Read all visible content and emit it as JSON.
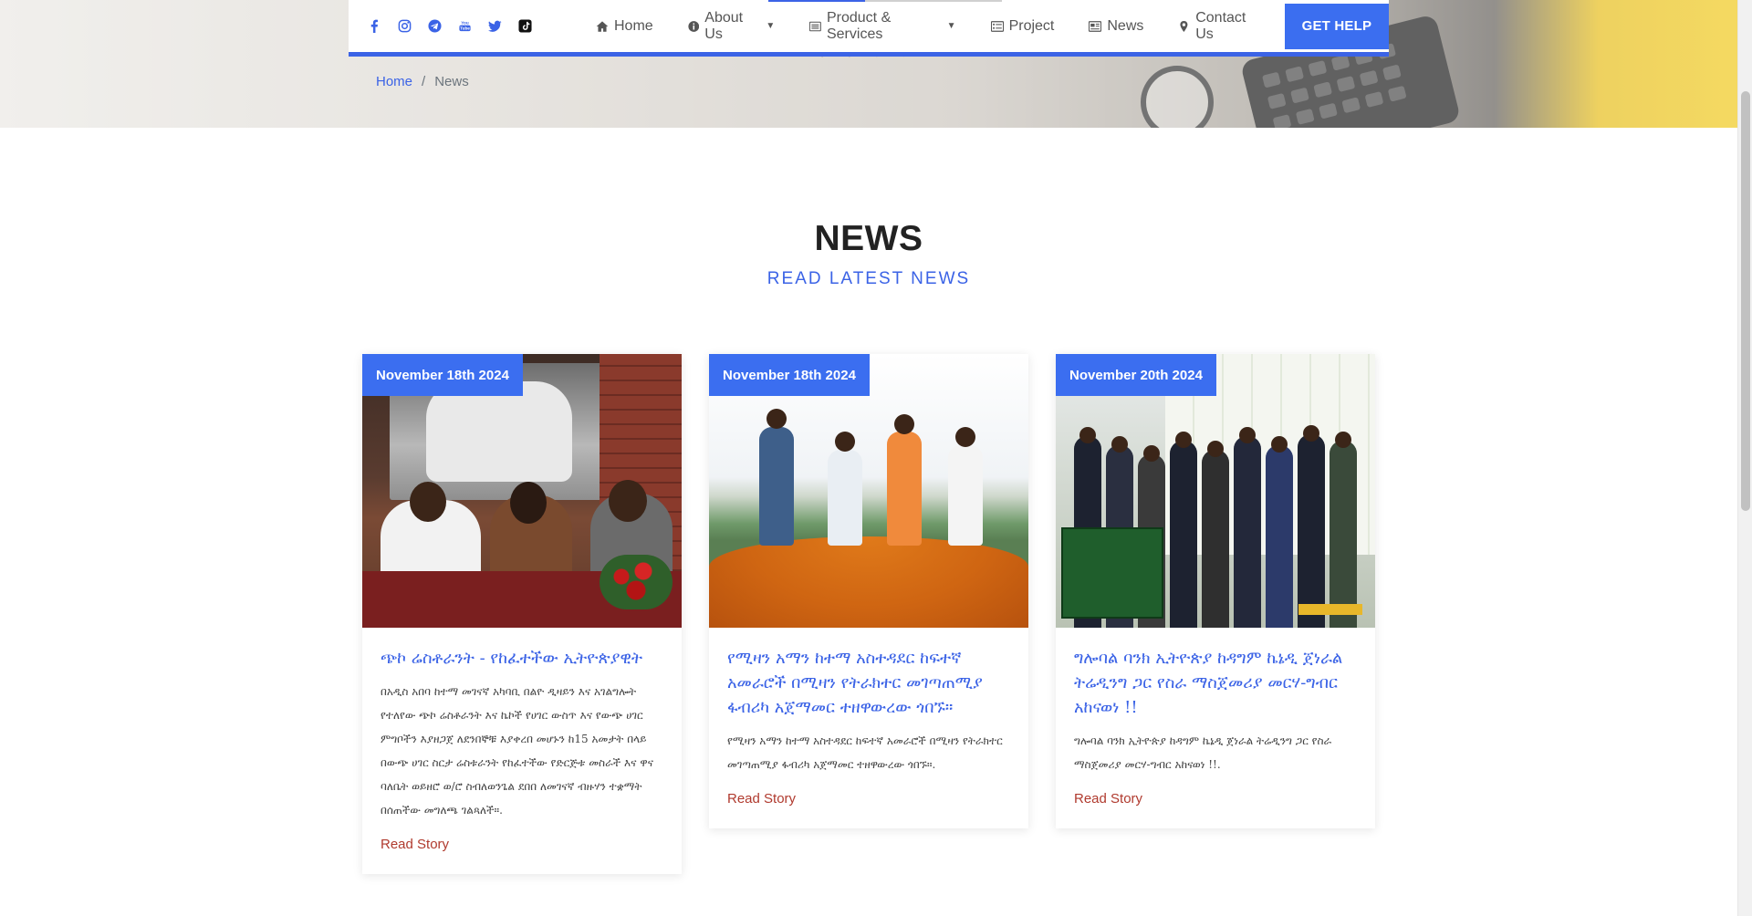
{
  "colors": {
    "accent": "#3b6ef0",
    "link": "#3b63e6",
    "read_more": "#b03a2e"
  },
  "social_icons": [
    "facebook-icon",
    "instagram-icon",
    "telegram-icon",
    "youtube-icon",
    "twitter-icon",
    "tiktok-icon"
  ],
  "nav": {
    "items": [
      {
        "label": "Home",
        "icon": "home-icon"
      },
      {
        "label": "About Us",
        "icon": "info-icon",
        "dropdown": true
      },
      {
        "label": "Product & Services",
        "icon": "list-icon",
        "dropdown": true
      },
      {
        "label": "Project",
        "icon": "tasks-icon"
      },
      {
        "label": "News",
        "icon": "newspaper-icon"
      },
      {
        "label": "Contact Us",
        "icon": "map-marker-icon"
      }
    ],
    "cta": "GET HELP"
  },
  "breadcrumb": {
    "home": "Home",
    "separator": "/",
    "current": "News"
  },
  "section": {
    "title": "NEWS",
    "subtitle": "READ LATEST NEWS"
  },
  "cards": [
    {
      "date": "November 18th 2024",
      "title": "ጭኮ ሬስቶራንት - የከፈተችው ኢትዮጵያዊት",
      "excerpt": "በአዲስ አበባ ከተማ መገናኛ አካባቢ በልዮ ዲዛይን እና አገልግሎት የተለየው ጭኮ ሬስቶራንት እና ኬኮች የሀገር ውስጥ እና የውጭ ሀገር ምግቦችን እያዘጋጀ ለደንበኞቹ እያቀረበ መሆኑን ከ15 አመታት በላይ በውጭ ሀገር ስርታ ሬስቱራንት የከፈተችው የድርጅቱ መስራች እና ዋና ባለቤት ወይዘሮ ወ/ሮ ስብለወንጌል ደበበ ለመገናኛ ብዙሃን ተቋማት በሰጠችው መግለጫ ገልጻለች።.",
      "link": "Read Story"
    },
    {
      "date": "November 18th 2024",
      "title": "የሚዛን አማን ከተማ አስተዳደር ከፍተኛ አመራሮች በሚዛን የትራክተር መገጣጠሚያ ፋብሪካ አጀማመር ተዘዋውረው ጎበኙ።",
      "excerpt": "የሚዛን አማን ከተማ አስተዳደር ከፍተኛ አመራሮች በሚዛን የትራክተር መገጣጠሚያ ፋብሪካ አጀማመር ተዘዋውረው ጎበኙ።.",
      "link": "Read Story"
    },
    {
      "date": "November 20th 2024",
      "title": "ግሎባል ባንክ ኢትዮጵያ ከዳግም ኬኔዲ ጀነራል ትሬዲንግ ጋር የስራ ማስጀመሪያ መርሃ-ግብር አከናወነ !!",
      "excerpt": "ግሎባል ባንክ ኢትዮጵያ ከዳግም ኬኔዲ ጀነራል ትሬዲንግ ጋር የስራ ማስጀመሪያ መርሃ-ግብር አከናወነ !!.",
      "link": "Read Story"
    }
  ]
}
